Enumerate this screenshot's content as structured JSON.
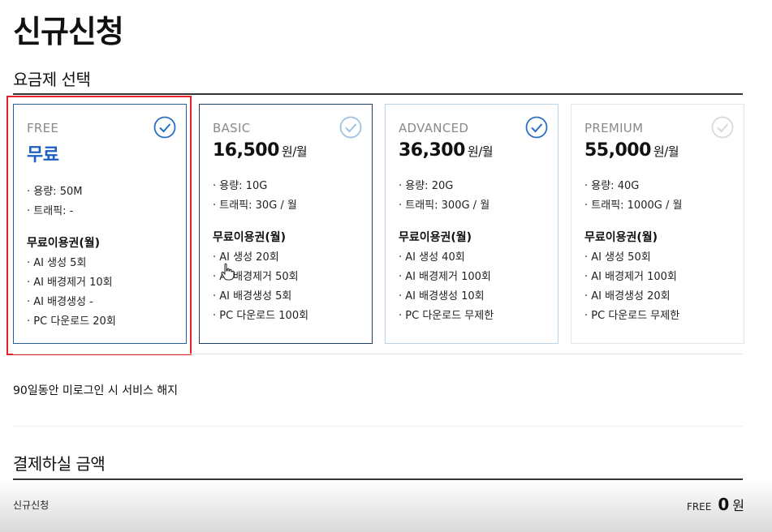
{
  "page": {
    "title": "신규신청"
  },
  "plan_section": {
    "title": "요금제 선택"
  },
  "plans": [
    {
      "tier": "FREE",
      "price": "무료",
      "unit": "",
      "specs": [
        "· 용량: 50M",
        "· 트래픽: -"
      ],
      "bonus_title": "무료이용권(월)",
      "bonus": [
        "· AI 생성 5회",
        "· AI 배경제거 10회",
        "· AI 배경생성 -",
        "· PC 다운로드 20회"
      ],
      "selected": true,
      "check_color": "#2a6fc0"
    },
    {
      "tier": "BASIC",
      "price": "16,500",
      "unit": "원/월",
      "specs": [
        "· 용량: 10G",
        "· 트래픽: 30G / 월"
      ],
      "bonus_title": "무료이용권(월)",
      "bonus": [
        "· AI 생성 20회",
        "· AI 배경제거 50회",
        "· AI 배경생성 5회",
        "· PC 다운로드 100회"
      ],
      "selected": false,
      "check_color": "#9fc1e0"
    },
    {
      "tier": "ADVANCED",
      "price": "36,300",
      "unit": "원/월",
      "specs": [
        "· 용량: 20G",
        "· 트래픽: 300G / 월"
      ],
      "bonus_title": "무료이용권(월)",
      "bonus": [
        "· AI 생성 40회",
        "· AI 배경제거 100회",
        "· AI 배경생성 10회",
        "· PC 다운로드 무제한"
      ],
      "selected": false,
      "check_color": "#2a6fc0"
    },
    {
      "tier": "PREMIUM",
      "price": "55,000",
      "unit": "원/월",
      "specs": [
        "· 용량: 40G",
        "· 트래픽: 1000G / 월"
      ],
      "bonus_title": "무료이용권(월)",
      "bonus": [
        "· AI 생성 50회",
        "· AI 배경제거 100회",
        "· AI 배경생성 20회",
        "· PC 다운로드 무제한"
      ],
      "selected": false,
      "check_color": "#d9d9d9"
    }
  ],
  "notice": "90일동안 미로그인 시 서비스 해지",
  "payment": {
    "title": "결제하실 금액",
    "row_label": "신규신청",
    "plan": "FREE",
    "amount": "0",
    "unit": "원"
  },
  "colors": {
    "accent": "#1e5fc2",
    "highlight": "#e6212b"
  }
}
